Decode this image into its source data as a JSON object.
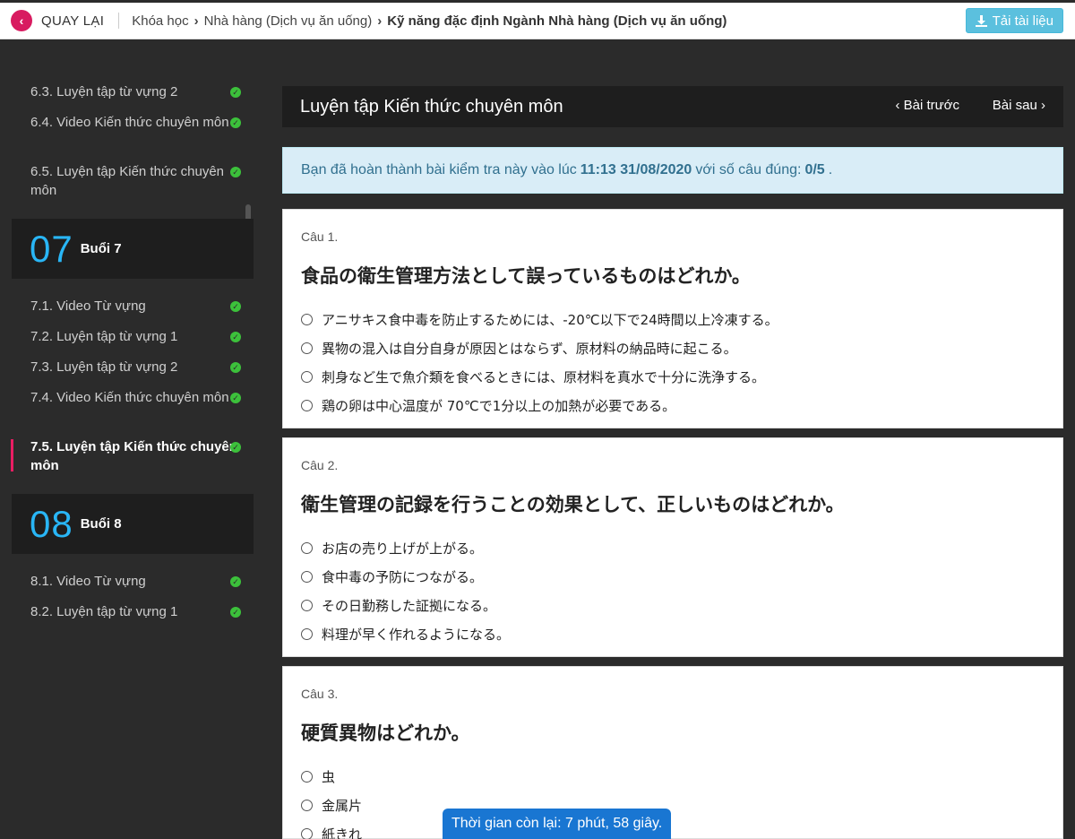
{
  "topbar": {
    "back_label": "QUAY LẠI",
    "breadcrumb": [
      "Khóa học",
      "Nhà hàng (Dịch vụ ăn uống)",
      "Kỹ năng đặc định Ngành Nhà hàng (Dịch vụ ăn uống)"
    ],
    "download_label": "Tải tài liệu"
  },
  "sidebar": {
    "lessons_top": [
      {
        "label": "6.3. Luyện tập từ vựng 2"
      },
      {
        "label": "6.4. Video Kiến thức chuyên môn"
      },
      {
        "label": "6.5. Luyện tập Kiến thức chuyên môn"
      }
    ],
    "session7": {
      "num": "07",
      "label": "Buổi 7"
    },
    "lessons_7": [
      {
        "label": "7.1. Video Từ vựng"
      },
      {
        "label": "7.2. Luyện tập từ vựng 1"
      },
      {
        "label": "7.3. Luyện tập từ vựng 2"
      },
      {
        "label": "7.4. Video Kiến thức chuyên môn"
      },
      {
        "label": "7.5. Luyện tập Kiến thức chuyên môn"
      }
    ],
    "session8": {
      "num": "08",
      "label": "Buổi 8"
    },
    "lessons_8": [
      {
        "label": "8.1. Video Từ vựng"
      },
      {
        "label": "8.2. Luyện tập từ vựng 1"
      }
    ]
  },
  "main": {
    "title": "Luyện tập Kiến thức chuyên môn",
    "prev_label": "Bài trước",
    "next_label": "Bài sau",
    "alert": {
      "prefix": "Bạn đã hoàn thành bài kiểm tra này vào lúc",
      "time": "11:13 31/08/2020",
      "middle": "với số câu đúng:",
      "score": "0/5",
      "suffix": "."
    },
    "questions": [
      {
        "num": "Câu 1.",
        "text": "食品の衛生管理方法として誤っているものはどれか。",
        "options": [
          "アニサキス食中毒を防止するためには、-20℃以下で24時間以上冷凍する。",
          "異物の混入は自分自身が原因とはならず、原材料の納品時に起こる。",
          "刺身など生で魚介類を食べるときには、原材料を真水で十分に洗浄する。",
          "鶏の卵は中心温度が 70℃で1分以上の加熱が必要である。"
        ]
      },
      {
        "num": "Câu 2.",
        "text": "衛生管理の記録を行うことの効果として、正しいものはどれか。",
        "options": [
          "お店の売り上げが上がる。",
          "食中毒の予防につながる。",
          "その日勤務した証拠になる。",
          "料理が早く作れるようになる。"
        ]
      },
      {
        "num": "Câu 3.",
        "text": "硬質異物はどれか。",
        "options": [
          "虫",
          "金属片",
          "紙きれ"
        ]
      }
    ]
  },
  "timer": "Thời gian còn lại: 7 phút, 58 giây."
}
